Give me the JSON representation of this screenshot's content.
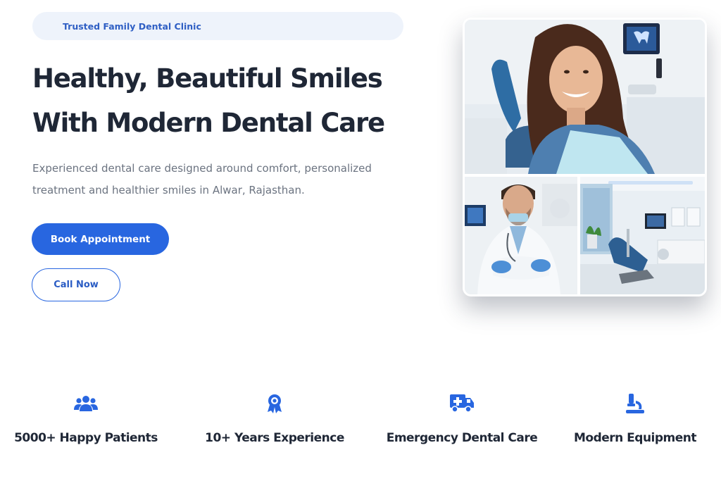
{
  "hero": {
    "badge": "Trusted Family Dental Clinic",
    "headline_line1": "Healthy, Beautiful Smiles",
    "headline_line2": "With Modern Dental Care",
    "lead": "Experienced dental care designed around comfort, personalized treatment and healthier smiles in Alwar, Rajasthan.",
    "book_button": "Book Appointment",
    "call_button": "Call Now"
  },
  "features": [
    {
      "icon": "users-icon",
      "label": "5000+ Happy Patients"
    },
    {
      "icon": "award-icon",
      "label": "10+ Years Experience"
    },
    {
      "icon": "ambulance-icon",
      "label": "Emergency Dental Care"
    },
    {
      "icon": "microscope-icon",
      "label": "Modern Equipment"
    }
  ],
  "colors": {
    "accent": "#2866e0",
    "heading": "#1f2736",
    "body_text": "#6b7380",
    "badge_bg": "#eef3fb"
  }
}
